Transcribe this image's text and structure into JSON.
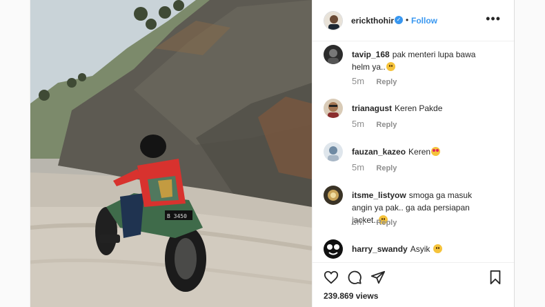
{
  "post": {
    "author": "erickthohir",
    "verified_icon": "verified-badge-icon",
    "separator": "•",
    "follow_label": "Follow",
    "more_label": "•••",
    "views": "239.869 views"
  },
  "comments": [
    {
      "username": "tavip_168",
      "text": "pak menteri lupa bawa helm ya..",
      "emoji": "face",
      "time": "5m",
      "reply": "Reply"
    },
    {
      "username": "trianagust",
      "text": "Keren Pakde",
      "emoji": "",
      "time": "5m",
      "reply": "Reply"
    },
    {
      "username": "fauzan_kazeo",
      "text": "Keren",
      "emoji": "heart-eyes",
      "time": "5m",
      "reply": "Reply"
    },
    {
      "username": "itsme_listyow",
      "text": "smoga ga masuk angin ya pak.. ga ada persiapan jacket..",
      "emoji": "face",
      "time": "5m",
      "reply": "Reply"
    },
    {
      "username": "harry_swandy",
      "text": "Asyik",
      "emoji": "face",
      "time": "",
      "reply": ""
    }
  ],
  "actions": {
    "like": "heart-icon",
    "comment": "comment-icon",
    "share": "share-icon",
    "save": "bookmark-icon"
  },
  "colors": {
    "link": "#3897f0",
    "muted": "#8e8e8e",
    "text": "#262626"
  }
}
